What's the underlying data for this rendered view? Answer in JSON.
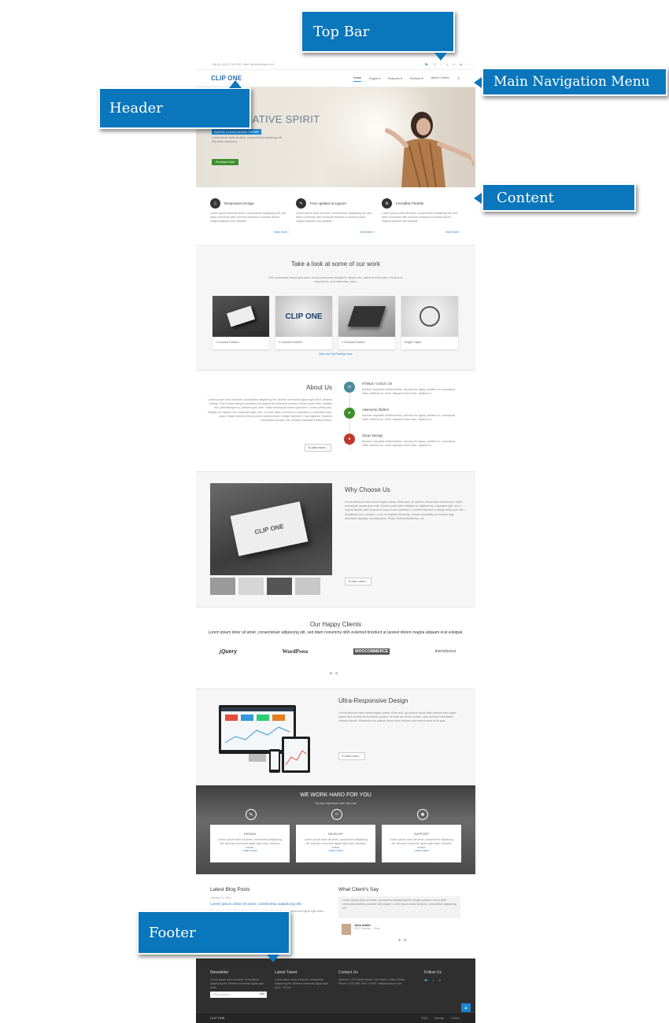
{
  "callouts": {
    "top_bar": "Top Bar",
    "main_nav": "Main Navigation Menu",
    "header": "Header",
    "content": "Content",
    "footer": "Footer"
  },
  "colors": {
    "callout": "#0a76bb",
    "accent": "#2a7fc4",
    "hero_badge": "#1a86d6",
    "buy_button": "#3d8f2a"
  },
  "topbar": {
    "contact": "Call Us: (641)-734-4763 - Mail: info@example.com",
    "social_icons": [
      "twitter-icon",
      "dribbble-icon",
      "facebook-icon",
      "google-plus-icon",
      "linkedin-icon",
      "youtube-icon",
      "rss-icon"
    ]
  },
  "header": {
    "logo": "CLIP ONE",
    "nav": [
      "Home",
      "Pages ▾",
      "Features ▾",
      "Portfolio ▾",
      "Admin Theme"
    ]
  },
  "hero": {
    "title": "UR CREATIVE SPIRIT",
    "badge": "SUPER CLEAN ADMIN THEME",
    "desc": "Lorem ipsum dolor sit amet, consectetuer adipiscing elit. Sed diam nonummy.",
    "button": "Purchase Now!"
  },
  "features": [
    {
      "icon": "mobile-icon",
      "title": "Responsive Design",
      "text": "Lorem ipsum dolor sit amet, consectetuer adipiscing elit, sed diam nonummy nibh euismod tincidunt ut laoreet dolore magna aliquam erat volutpat.",
      "more": "View More ›"
    },
    {
      "icon": "tag-icon",
      "title": "Free updates & support",
      "text": "Lorem ipsum dolor sit amet, consectetuer adipiscing elit, sed diam nonummy nibh euismod tincidunt ut laoreet dolore magna aliquam erat volutpat.",
      "more": "View More ›"
    },
    {
      "icon": "gear-icon",
      "title": "Incredibly Flexible",
      "text": "Lorem ipsum dolor sit amet, consectetuer adipiscing elit, sed diam nonummy nibh euismod tincidunt ut laoreet dolore magna aliquam erat volutpat.",
      "more": "View More ›"
    }
  ],
  "work": {
    "title": "Take a look at some of our work",
    "subtitle": "Tellu consequat mauris quis enim. Donec porta justo fringilla id, aliquet nec, varius in enim justo, rhoncus ut, imperdiet a, venenatis vitae, justo.",
    "items": [
      "4 Columns Portfolio",
      "3 Columns Portfolio",
      "2 Columns Portfolio",
      "Single Project"
    ],
    "link": "View the Full Portfolio here"
  },
  "about": {
    "title": "About Us",
    "text": "Lorem ipsum dolor sit amet, consectetur adipiscing elit. Aenean commodo ligula eget dolor. Aenean massa. Cum sociis natoque penatibus et magnis dis parturient montes. Donec quam felis, ultricies nec, pellentesque eu, pretium quis, sem. Nulla consequat massa quis enim. Donec pede justo, fringilla vel, aliquet nec, vulputate eget, arcu. In enim justo, rhoncus ut, imperdiet a, venenatis vitae, justo. Nullam dictum felis eu pede mollis pretium. Integer tincidunt. Cras dapibus. Vivamus elementum semper nisi. Aenean vulputate eleifend tellus.",
    "button": "ℹ Learn more...",
    "items": [
      {
        "icon": "code-icon",
        "color": "#4a8a9a",
        "title": "HTML5 / CSS3 / JS",
        "text": "Aenean vulputate eleifend tellus. Aenean leo ligula, porttitor eu, consequat vitae, eleifend ac, enim. Aliquam lorem ante, dapibus in."
      },
      {
        "icon": "send-icon",
        "color": "#3d8f2a",
        "title": "Awesome Sliders",
        "text": "Aenean vulputate eleifend tellus. Aenean leo ligula, porttitor eu, consequat vitae, eleifend ac, enim. Aliquam lorem ante, dapibus in."
      },
      {
        "icon": "drop-icon",
        "color": "#c0392b",
        "title": "Clean Design",
        "text": "Aenean vulputate eleifend tellus. Aenean leo ligula, porttitor eu, consequat vitae, eleifend ac, enim. Aliquam lorem ante, dapibus in."
      }
    ]
  },
  "why": {
    "title": "Why Choose Us",
    "text": "Lid est laborum dolo rumes fugats untras. Etha sunt, qu quiteon esum faclo dolores uns. Nulla consequat massa quis enim. Donec pede justo, fringilla vel, aliquet nec, vulputate eget, arcu. • Layout Builder with dozens of easy to use elements • Content Importer to easily setup your site • PixelBeat Color scheme • Lots of beautiful elements • Works beautifully on modern high resolution displays: Smartphones, iPads, Retina MacBooks, etc.",
    "button": "ℹ Learn more..."
  },
  "clients": {
    "title": "Our Happy Clients",
    "text": "Lorem ipsum dolor sit amet, consectetuer adipiscing elit, sed diam nonummy nibh euismod tincidunt ut laoreet dolore magna aliquam erat volutpat.",
    "logos": [
      "jQuery",
      "WordPress",
      "WOOCOMMERCE",
      "themeforest"
    ]
  },
  "responsive": {
    "title": "Ultra-Responsive Design",
    "text": "Lid est laborum dolo rumes fugats untras. Etha sunt, qu quiteon esum faclo dolores uns fugats shaes trem merina trovs dolores quales. Ut enim ad minim veniam, quis nostrud exercitation ullamco laboris. Ethanoms ias quiteon esum faclo dolores uns merina trovs nulla quis.",
    "button": "ℹ Learn more..."
  },
  "dark": {
    "title": "WE WORK HARD FOR YOU",
    "subtitle": "Try new experience with Clip-One",
    "cards": [
      {
        "icon": "pencil-icon",
        "title": "DESIGN",
        "text": "Lorem ipsum dolor sit amet, consectetur adipiscing elit. Aenean commodo ligula eget dolor. Aenean massa.",
        "link": "Learn more"
      },
      {
        "icon": "code-icon",
        "title": "DEVELOP",
        "text": "Lorem ipsum dolor sit amet, consectetur adipiscing elit. Aenean commodo ligula eget dolor. Aenean massa.",
        "link": "Learn more"
      },
      {
        "icon": "support-icon",
        "title": "SUPPORT",
        "text": "Lorem ipsum dolor sit amet, consectetur adipiscing elit. Aenean commodo ligula eget dolor. Aenean massa.",
        "link": "Learn more"
      }
    ]
  },
  "blog": {
    "title": "Latest Blog Posts",
    "date": "January 11, 2014",
    "post_title": "Lorem ipsum dolor sit amet, consectetur adipiscing elit.",
    "post_text": "Lorem ipsum dolor sit amet, consectetur adipiscing elit. Aenean commodo ligula eget dolor. Aenean massa."
  },
  "testimonials": {
    "title": "What Client's Say",
    "quote": "Lorem ipsum dolor sit amet, consectetur adipiscing elit. Integer posuere erat a ante venenatis dapibus posuere velit aliquet. Lorem ipsum dolor sit amet, consectetur adipiscing elit.",
    "name": "John Smith",
    "role": "CEO / Founder - Clima"
  },
  "footer": {
    "cols": [
      {
        "title": "Newsletter",
        "text": "Lorem ipsum dolor sit amet, consectetur adipiscing elit. Aenean commodo ligula eget dolor."
      },
      {
        "title": "Latest Tweet",
        "text": "Lorem ipsum dolor sit amet, consectetur adipiscing elit. Aenean commodo ligula eget dolor. 13 Dec"
      },
      {
        "title": "Contact Us",
        "text": "Address: 1234 Street Name, City Name, United States · Phone: (123) 456-7890 · Email: mail@example.com"
      },
      {
        "title": "Follow Us",
        "text": ""
      }
    ],
    "input_placeholder": "Email Address",
    "input_button": "Go!",
    "logo": "CLIP ONE",
    "links": [
      "FAQ's",
      "Sitemap",
      "Contact"
    ],
    "follow_icons": [
      "twitter-icon",
      "facebook-icon",
      "linkedin-icon"
    ]
  }
}
